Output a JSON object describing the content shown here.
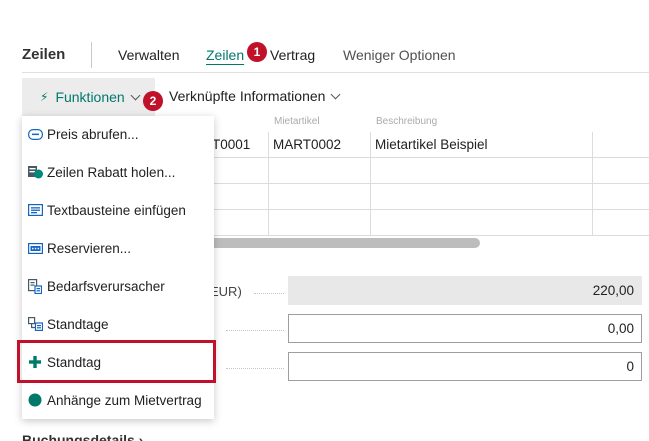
{
  "header": {
    "section_title": "Zeilen",
    "tabs": [
      {
        "label": "Verwalten"
      },
      {
        "label": "Zeilen"
      },
      {
        "label": "Vertrag"
      },
      {
        "label": "Weniger Optionen"
      }
    ]
  },
  "badges": {
    "one": "1",
    "two": "2"
  },
  "actions": {
    "functions_label": "Funktionen",
    "related_label": "Verknüpfte Informationen"
  },
  "menu": {
    "items": [
      {
        "label": "Preis abrufen...",
        "icon": "price-tag-icon"
      },
      {
        "label": "Zeilen Rabatt holen...",
        "icon": "discount-icon"
      },
      {
        "label": "Textbausteine einfügen",
        "icon": "text-block-icon"
      },
      {
        "label": "Reservieren...",
        "icon": "reserve-icon"
      },
      {
        "label": "Bedarfsverursacher",
        "icon": "demand-source-icon"
      },
      {
        "label": "Standtage",
        "icon": "standing-days-icon"
      },
      {
        "label": "Standtag",
        "icon": "plus-icon"
      },
      {
        "label": "Anhänge zum Mietvertrag",
        "icon": "attachment-dot-icon"
      }
    ]
  },
  "grid": {
    "header": [
      "Mietartikel",
      "Beschreibung"
    ],
    "rows": [
      [
        "T0001",
        "MART0002",
        "Mietartikel Beispiel",
        ""
      ],
      [
        "",
        "",
        "",
        ""
      ],
      [
        "",
        "",
        "",
        ""
      ],
      [
        "",
        "",
        "",
        ""
      ]
    ]
  },
  "totals": {
    "label_fragment": "EUR)",
    "rows": [
      {
        "value": "220,00"
      },
      {
        "value": "0,00"
      },
      {
        "value": "0"
      }
    ]
  },
  "bottom": {
    "heading": "Buchungsdetails ›"
  },
  "colors": {
    "accent": "#00796b",
    "badge": "#c0102a",
    "highlight": "#c0102a"
  }
}
